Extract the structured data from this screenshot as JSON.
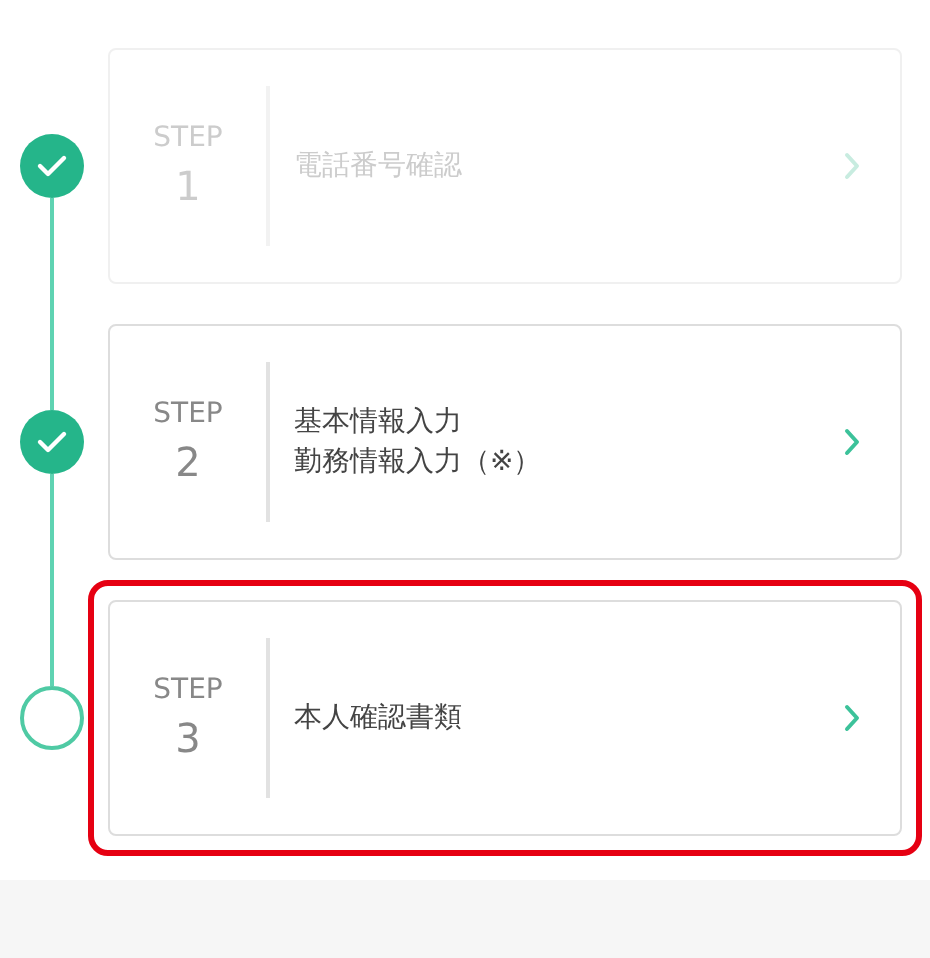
{
  "steps": [
    {
      "label": "STEP",
      "number": "1",
      "lines": [
        "電話番号確認"
      ],
      "completed": true,
      "disabled": true,
      "highlighted": false
    },
    {
      "label": "STEP",
      "number": "2",
      "lines": [
        "基本情報入力",
        "勤務情報入力（※）"
      ],
      "completed": true,
      "disabled": false,
      "highlighted": false
    },
    {
      "label": "STEP",
      "number": "3",
      "lines": [
        "本人確認書類"
      ],
      "completed": false,
      "disabled": false,
      "highlighted": true
    }
  ]
}
